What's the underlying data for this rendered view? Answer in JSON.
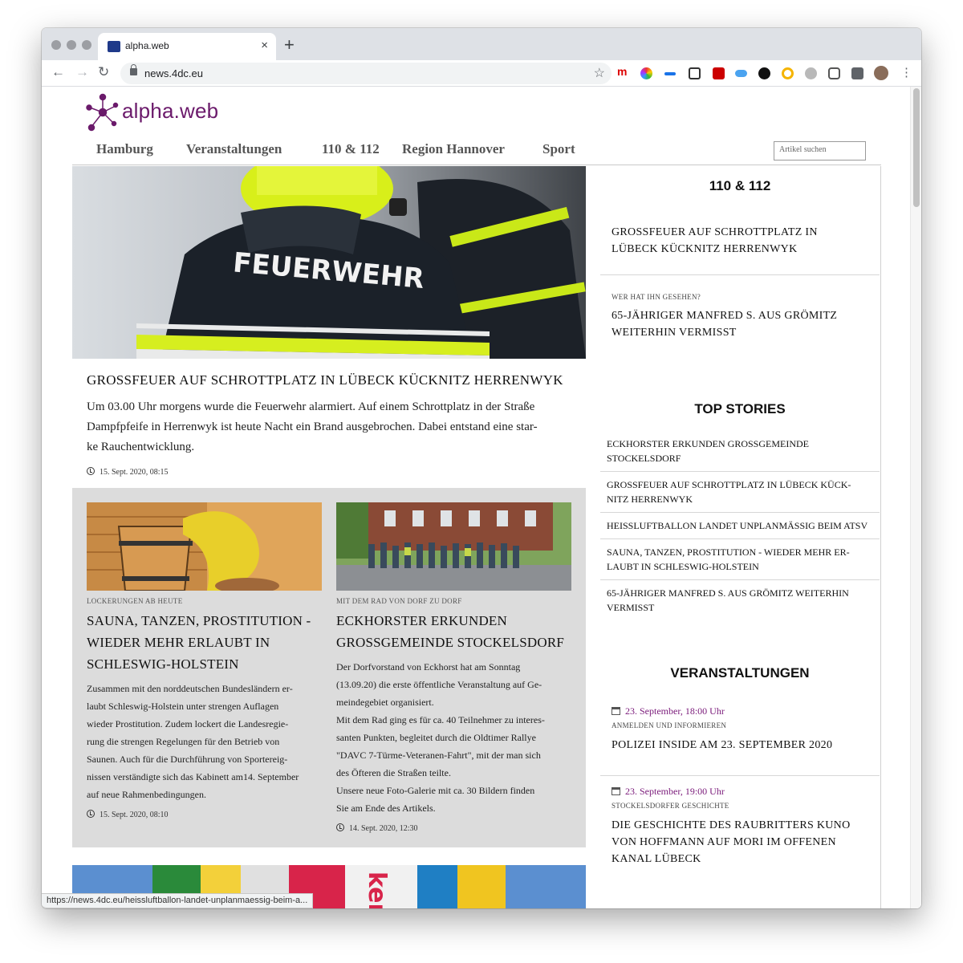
{
  "browser": {
    "tab_title": "alpha.web",
    "tab_close": "×",
    "new_tab": "+",
    "url": "news.4dc.eu",
    "status_url": "https://news.4dc.eu/heissluftballon-landet-unplanmaessig-beim-a..."
  },
  "site": {
    "logo_text": "alpha.web",
    "brand_color": "#6b1a6b",
    "nav": [
      "Hamburg",
      "Veranstaltungen",
      "110 & 112",
      "Region Hannover",
      "Sport"
    ],
    "search_placeholder": "Artikel suchen"
  },
  "hero": {
    "image_label": "FEUERWEHR",
    "title": "GROSSFEUER AUF SCHROTTPLATZ IN LÜBECK KÜCKNITZ HERRENWYK",
    "text_lines": [
      "Um 03.00 Uhr morgens wurde die Feuerwehr alarmiert. Auf einem Schrottplatz in der Straße",
      "Dampfpfeife in Herrenwyk ist heute Nacht ein Brand ausgebrochen. Dabei entstand eine star-",
      "ke Rauchentwicklung."
    ],
    "date": "15. Sept. 2020, 08:15"
  },
  "teasers": [
    {
      "kicker": "LOCKERUNGEN AB HEUTE",
      "title_lines": [
        "SAUNA, TANZEN, PROSTITUTION -",
        "WIEDER MEHR ERLAUBT IN",
        "SCHLESWIG-HOLSTEIN"
      ],
      "text_lines": [
        "Zusammen mit den norddeutschen Bundesländern er-",
        "laubt Schleswig-Holstein unter strengen Auflagen",
        "wieder Prostitution. Zudem lockert die Landesregie-",
        "rung die strengen Regelungen für den Betrieb von",
        "Saunen. Auch für die Durchführung von Sportereig-",
        "nissen verständigte sich das Kabinett am14. September",
        "auf neue Rahmenbedingungen."
      ],
      "date": "15. Sept. 2020, 08:10"
    },
    {
      "kicker": "MIT DEM RAD VON DORF ZU DORF",
      "title_lines": [
        "ECKHORSTER ERKUNDEN",
        "GROSSGEMEINDE STOCKELSDORF"
      ],
      "text_lines": [
        "Der Dorfvorstand von Eckhorst hat am Sonntag",
        "(13.09.20) die erste öffentliche Veranstaltung auf Ge-",
        "meindegebiet organisiert.",
        "Mit dem Rad ging es für ca. 40 Teilnehmer zu interes-",
        "santen Punkten, begleitet durch die Oldtimer Rallye",
        "\"DAVC 7-Türme-Veteranen-Fahrt\", mit der man sich",
        "des Öfteren die Straßen teilte.",
        "Unsere neue Foto-Galerie mit ca. 30 Bildern finden",
        "Sie am Ende des Artikels."
      ],
      "date": "14. Sept. 2020, 12:30"
    }
  ],
  "next_image_label": "ker.",
  "sidebar": {
    "section_110": {
      "heading": "110 & 112",
      "items": [
        {
          "kicker": "",
          "title_lines": [
            "GROSSFEUER AUF SCHROTTPLATZ IN",
            "LÜBECK KÜCKNITZ HERRENWYK"
          ]
        },
        {
          "kicker": "WER HAT IHN GESEHEN?",
          "title_lines": [
            "65-JÄHRIGER MANFRED S. AUS GRÖMITZ",
            "WEITERHIN VERMISST"
          ]
        }
      ]
    },
    "top_stories": {
      "heading": "TOP STORIES",
      "items": [
        [
          "ECKHORSTER ERKUNDEN GROSSGEMEINDE",
          "STOCKELSDORF"
        ],
        [
          "GROSSFEUER AUF SCHROTTPLATZ IN LÜBECK KÜCK-",
          "NITZ HERRENWYK"
        ],
        [
          "HEISSLUFTBALLON LANDET UNPLANMÄSSIG BEIM ATSV"
        ],
        [
          "SAUNA, TANZEN, PROSTITUTION - WIEDER MEHR ER-",
          "LAUBT IN SCHLESWIG-HOLSTEIN"
        ],
        [
          "65-JÄHRIGER MANFRED S. AUS GRÖMITZ WEITERHIN",
          "VERMISST"
        ]
      ]
    },
    "events": {
      "heading": "VERANSTALTUNGEN",
      "items": [
        {
          "date": "23. September, 18:00 Uhr",
          "kicker": "ANMELDEN UND INFORMIEREN",
          "title_lines": [
            "POLIZEI INSIDE AM 23. SEPTEMBER 2020"
          ]
        },
        {
          "date": "23. September, 19:00 Uhr",
          "kicker": "STOCKELSDORFER GESCHICHTE",
          "title_lines": [
            "DIE GESCHICHTE DES RAUBRITTERS KUNO",
            "VON HOFFMANN AUF MORI IM OFFENEN",
            "KANAL LÜBECK"
          ]
        }
      ]
    }
  }
}
